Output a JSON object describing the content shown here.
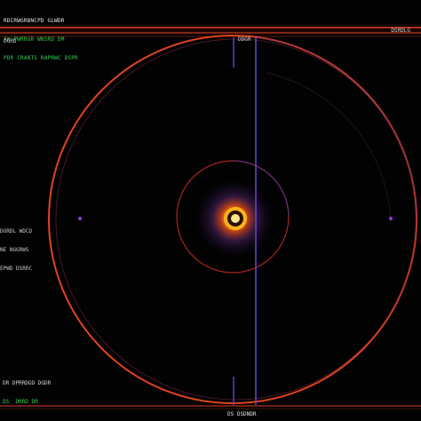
{
  "top_hud": {
    "line1": "RDCRWGRBNCPD GLWDR",
    "line2": "AW PWRRGR WNSRD DM",
    "line3": "PDR CRANTS RAPRWC DSPR"
  },
  "top_bar": {
    "left_label": "DGRD",
    "right_label": "DSRDLG",
    "center_label": "DDGR"
  },
  "left_readout": {
    "line1": "DGRDL WDCD",
    "line2": "NE NGGRWS",
    "line3": "EPWD DSRRC"
  },
  "bottom_left": {
    "line1": "DR DPRRDGD DGDR",
    "line2": "DS  DRRD DR"
  },
  "bottom_center": "DS DSDNDR",
  "colors": {
    "orbit_outer": "#e0421f",
    "orbit_inner": "#a8261a",
    "scanline": "#6a3cd8",
    "core": "#ffb21a",
    "bar": "#c43820"
  }
}
